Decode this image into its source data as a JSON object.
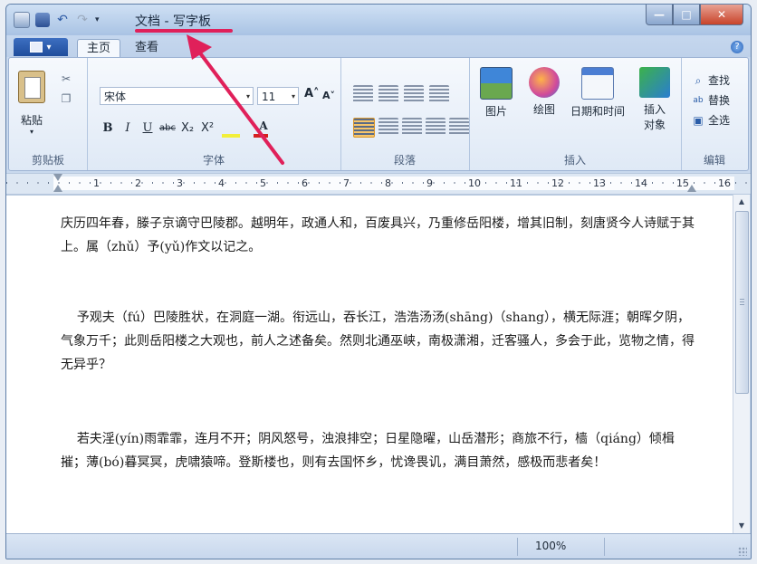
{
  "window": {
    "title": "文档 - 写字板",
    "controls": {
      "minimize": "—",
      "maximize": "□",
      "close": "✕"
    }
  },
  "quick_access": {
    "app_icon": "wordpad-app-icon",
    "save_icon": "save-icon",
    "undo_icon": "undo-icon",
    "redo_icon": "redo-icon",
    "customize_icon": "dropdown-arrow-icon",
    "undo_glyph": "↶",
    "redo_glyph": "↷",
    "customize_glyph": "▾"
  },
  "tabs": {
    "app_menu_arrow": "▾",
    "items": [
      {
        "label": "主页",
        "active": true
      },
      {
        "label": "查看",
        "active": false
      }
    ],
    "help": "?"
  },
  "ribbon": {
    "clipboard": {
      "label": "剪贴板",
      "paste": "粘贴",
      "paste_arrow": "▾",
      "cut_icon": "scissors-icon",
      "copy_icon": "copy-icon",
      "cut_glyph": "✂",
      "copy_glyph": "❐"
    },
    "font": {
      "label": "字体",
      "font_name": "宋体",
      "font_size": "11",
      "grow": "A˄",
      "shrink": "A˅",
      "bold": "B",
      "italic": "I",
      "underline": "U",
      "strike": "abc",
      "subscript": "X₂",
      "superscript": "X²",
      "color_letter": "A",
      "dd_arrow": "▾",
      "highlight_color": "#f2ef3a",
      "font_color": "#d42020"
    },
    "paragraph": {
      "label": "段落"
    },
    "insert": {
      "label": "插入",
      "picture": "图片",
      "paint": "绘图",
      "datetime": "日期和时间",
      "object_line1": "插入",
      "object_line2": "对象"
    },
    "editing": {
      "label": "编辑",
      "find": "查找",
      "replace": "替换",
      "select_all": "全选",
      "find_glyph": "⌕",
      "replace_glyph": "ab",
      "select_all_glyph": "▣"
    }
  },
  "ruler": {
    "numbers": [
      "1",
      "2",
      "3",
      "4",
      "5",
      "6",
      "7",
      "8",
      "9",
      "10",
      "11",
      "12",
      "13",
      "14",
      "15",
      "16"
    ]
  },
  "document": {
    "paragraphs": [
      "庆历四年春，滕子京谪守巴陵郡。越明年，政通人和，百废具兴，乃重修岳阳楼，增其旧制，刻唐贤今人诗赋于其上。属（zhǔ）予(yǔ)作文以记之。",
      "    予观夫（fú）巴陵胜状，在洞庭一湖。衔远山，吞长江，浩浩汤汤(shāng)（shang），横无际涯；朝晖夕阴，气象万千；此则岳阳楼之大观也，前人之述备矣。然则北通巫峡，南极潇湘，迁客骚人，多会于此，览物之情，得无异乎？",
      "    若夫淫(yín)雨霏霏，连月不开；阴风怒号，浊浪排空；日星隐曜，山岳潜形；商旅不行，樯（qiáng）倾楫摧；薄(bó)暮冥冥，虎啸猿啼。登斯楼也，则有去国怀乡，忧谗畏讥，满目萧然，感极而悲者矣！"
    ]
  },
  "scrollbar": {
    "up": "▲",
    "down": "▼"
  },
  "status": {
    "zoom": "100%"
  },
  "colors": {
    "annotation": "#e0205a",
    "accent": "#2a63b8"
  }
}
